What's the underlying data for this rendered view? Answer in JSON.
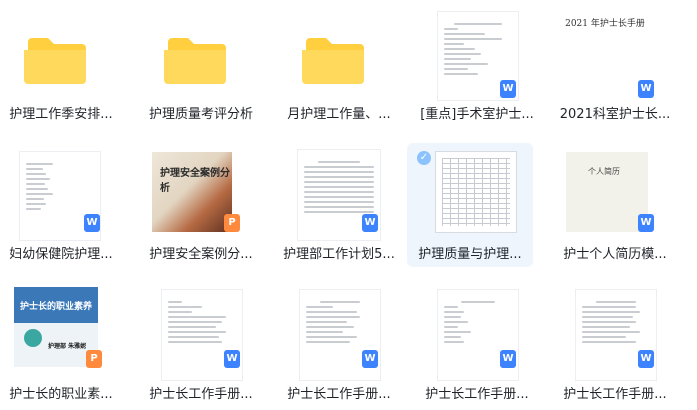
{
  "files": [
    {
      "label": "护理工作季安排...",
      "type": "folder"
    },
    {
      "label": "护理质量考评分析",
      "type": "folder"
    },
    {
      "label": "月护理工作量、...",
      "type": "folder"
    },
    {
      "label": "[重点]手术室护士...",
      "type": "word",
      "badge": "W"
    },
    {
      "label": "2021科室护士长...",
      "type": "word",
      "badge": "W",
      "thumb_text": "2021 年护士长手册"
    },
    {
      "label": "妇幼保健院护理...",
      "type": "word",
      "badge": "W"
    },
    {
      "label": "护理安全案例分...",
      "type": "ppt",
      "badge": "P",
      "thumb_text": "护理安全案例分析"
    },
    {
      "label": "护理部工作计划5...",
      "type": "word",
      "badge": "W"
    },
    {
      "label": "护理质量与护理...",
      "type": "word",
      "badge": "W",
      "selected": true
    },
    {
      "label": "护士个人简历模...",
      "type": "word",
      "badge": "W",
      "thumb_text": "个人简历"
    },
    {
      "label": "护士长的职业素...",
      "type": "ppt",
      "badge": "P",
      "thumb_text": "护士长的职业素养",
      "thumb_sub1": "护理部",
      "thumb_sub2": "朱雅妮"
    },
    {
      "label": "护士长工作手册...",
      "type": "word",
      "badge": "W"
    },
    {
      "label": "护士长工作手册...",
      "type": "word",
      "badge": "W"
    },
    {
      "label": "护士长工作手册...",
      "type": "word",
      "badge": "W"
    },
    {
      "label": "护士长工作手册...",
      "type": "word",
      "badge": "W"
    }
  ],
  "colors": {
    "folder": "#ffcf3f",
    "folder_tab": "#ffd95c",
    "word_badge": "#3d83ff",
    "ppt_badge": "#ff8a3d",
    "selected_bg": "#eef5fd"
  }
}
